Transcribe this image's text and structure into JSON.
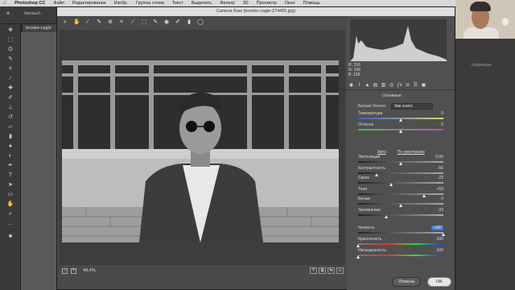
{
  "menubar": {
    "app": "Photoshop CC",
    "items": [
      "Файл",
      "Редактирование",
      "Изобр.",
      "Группы слоев",
      "Текст",
      "Выделить",
      "Фильтр",
      "3D",
      "Просмотр",
      "Окно",
      "Помощь"
    ]
  },
  "options_bar": {
    "label": "Автовыб.:"
  },
  "document_tab": {
    "title": "brooke-cagle"
  },
  "dialog": {
    "title": "Camera Raw (brooke-cagle-274465.jpg)",
    "zoom": "49,4%",
    "toolbar_icons": [
      "zoom-icon",
      "hand-icon",
      "white-balance-icon",
      "color-sampler-icon",
      "target-adjust-icon",
      "crop-icon",
      "straighten-icon",
      "transform-icon",
      "spot-removal-icon",
      "red-eye-icon",
      "adjustment-brush-icon",
      "graduated-filter-icon",
      "radial-filter-icon"
    ],
    "view_buttons": [
      "Y",
      "⧉",
      "⇆",
      "≡"
    ],
    "cancel_label": "Отмена",
    "ok_label": "OK"
  },
  "panel": {
    "rgb": {
      "r": "R: 156",
      "g": "G: 156",
      "b": "B: 156"
    },
    "section_title": "Основные",
    "white_balance": {
      "label": "Баланс белого:",
      "value": "Как снято"
    },
    "links": {
      "auto": "Авто",
      "default": "По умолчанию"
    },
    "sliders": [
      {
        "name": "Температура",
        "value": "0",
        "pos": 0.5,
        "kind": "temp"
      },
      {
        "name": "Оттенок",
        "value": "0",
        "pos": 0.5,
        "kind": "tint"
      },
      {
        "name": "Экспозиция",
        "value": "0,00",
        "pos": 0.5,
        "kind": "gray"
      },
      {
        "name": "Контрастность",
        "value": "-56",
        "pos": 0.22,
        "kind": "gray"
      },
      {
        "name": "Света",
        "value": "-22",
        "pos": 0.39,
        "kind": "gray"
      },
      {
        "name": "Тени",
        "value": "+53",
        "pos": 0.77,
        "kind": "gray"
      },
      {
        "name": "Белые",
        "value": "0",
        "pos": 0.5,
        "kind": "gray"
      },
      {
        "name": "Затемнение",
        "value": "-33",
        "pos": 0.33,
        "kind": "gray"
      },
      {
        "name": "Четкость",
        "value": "+100",
        "pos": 1.0,
        "kind": "gray",
        "highlight": true
      },
      {
        "name": "Красочность",
        "value": "-100",
        "pos": 0.0,
        "kind": "sat"
      },
      {
        "name": "Насыщенность",
        "value": "-100",
        "pos": 0.0,
        "kind": "sat"
      }
    ]
  },
  "right_panel": {
    "label": "Коррекция"
  }
}
